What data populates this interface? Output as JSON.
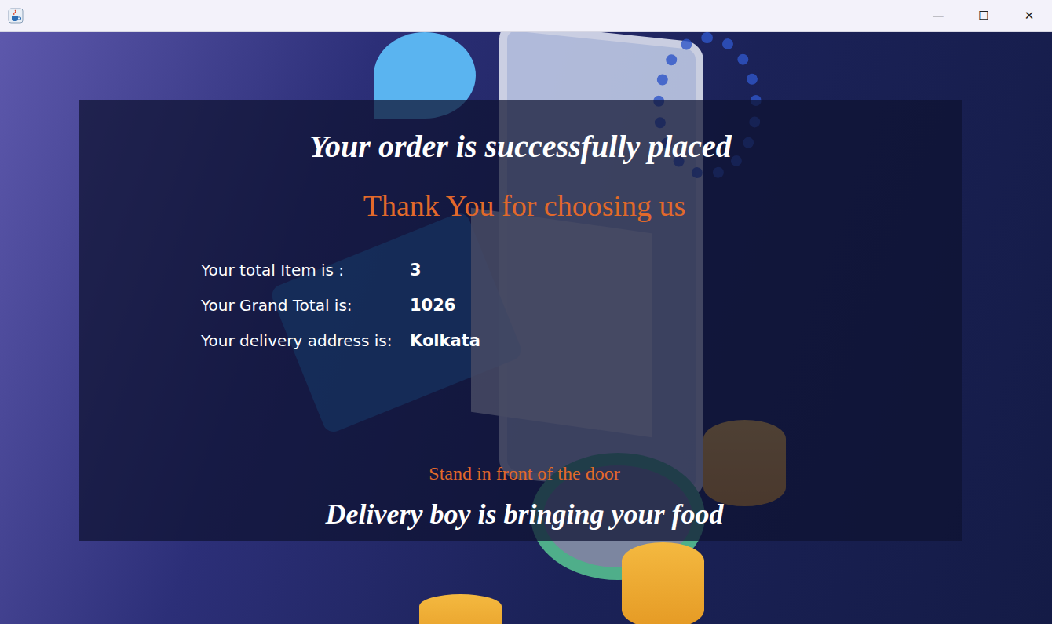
{
  "window": {
    "controls": {
      "minimize": "—",
      "maximize": "☐",
      "close": "✕"
    }
  },
  "confirmation": {
    "title": "Your order is successfully placed",
    "subtitle": "Thank You for choosing us",
    "details": [
      {
        "label": "Your total Item is :",
        "value": "3"
      },
      {
        "label": "Your Grand Total is:",
        "value": "1026"
      },
      {
        "label": "Your delivery address is:",
        "value": "Kolkata"
      }
    ],
    "note": "Stand in front of the door",
    "footer": "Delivery boy is bringing your food"
  }
}
